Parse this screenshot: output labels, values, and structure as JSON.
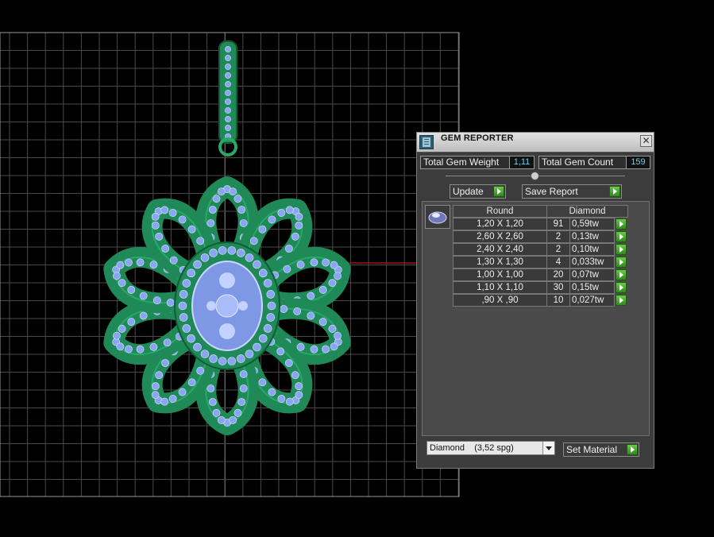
{
  "panel": {
    "title": "GEM REPORTER",
    "close_glyph": "✕",
    "total_weight_label": "Total Gem Weight",
    "total_weight_value": "1,11",
    "total_count_label": "Total Gem Count",
    "total_count_value": "159",
    "update_label": "Update",
    "save_report_label": "Save Report",
    "table": {
      "shape_header": "Round",
      "material_header": "Diamond",
      "rows": [
        {
          "size": "1,20 X 1,20",
          "count": "91",
          "weight": "0,59tw"
        },
        {
          "size": "2,60 X 2,60",
          "count": "2",
          "weight": "0,13tw"
        },
        {
          "size": "2,40 X 2,40",
          "count": "2",
          "weight": "0,10tw"
        },
        {
          "size": "1,30 X 1,30",
          "count": "4",
          "weight": "0,033tw"
        },
        {
          "size": "1,00 X 1,00",
          "count": "20",
          "weight": "0,07tw"
        },
        {
          "size": "1,10 X 1,10",
          "count": "30",
          "weight": "0,15tw"
        },
        {
          "size": ",90 X ,90",
          "count": "10",
          "weight": "0,027tw"
        }
      ]
    },
    "material_select": {
      "name": "Diamond",
      "density": "(3,52 spg)"
    },
    "set_material_label": "Set Material"
  },
  "colors": {
    "value_text": "#67d4ee",
    "action_arrow": "#4fb232",
    "metal": "#1f8a57",
    "gem": "#8aa6f2",
    "grid": "#4a4a4a",
    "axis": "#a01818"
  },
  "icons": {
    "title": "gem-reporter-icon",
    "thumbnail": "round-gem-icon",
    "actions": "play-arrow-icon"
  }
}
